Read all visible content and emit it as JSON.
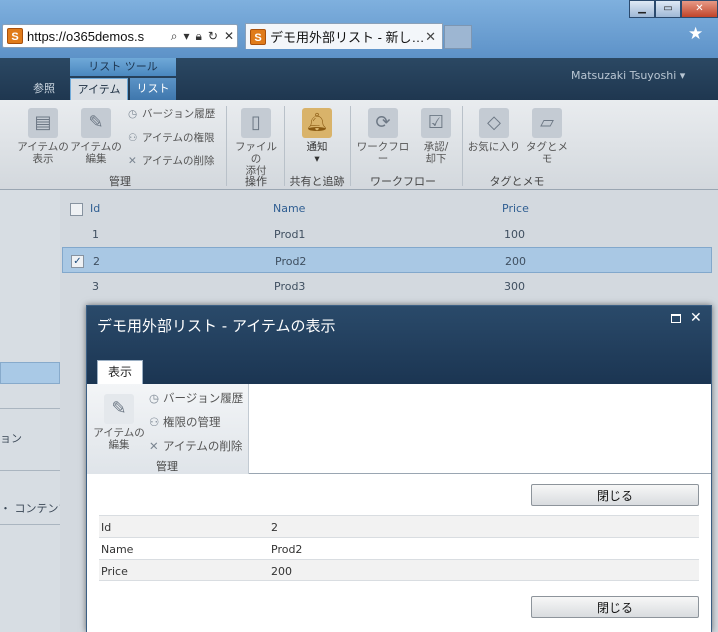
{
  "browser": {
    "favicon": "S",
    "address": "https://o365demos.s",
    "tab_title": "デモ用外部リスト - 新し…",
    "tab_favicon": "S"
  },
  "sp": {
    "context_group": "リスト ツール",
    "tabs": {
      "browse": "参照",
      "items": "アイテム",
      "list": "リスト"
    },
    "user": "Matsuzaki Tsuyoshi ▾"
  },
  "ribbon": {
    "view_item": [
      "アイテムの",
      "表示"
    ],
    "edit_item": [
      "アイテムの",
      "編集"
    ],
    "version_history": "バージョン履歴",
    "item_permissions": "アイテムの権限",
    "delete_item": "アイテムの削除",
    "group_manage": "管理",
    "attach_file": [
      "ファイルの",
      "添付"
    ],
    "group_actions": "操作",
    "alert": "通知",
    "group_share": "共有と追跡",
    "workflow": "ワークフロー",
    "approve": [
      "承認/",
      "却下"
    ],
    "group_workflow": "ワークフロー",
    "like": "お気に入り",
    "tags": "タグとメモ",
    "group_tags": "タグとメモ"
  },
  "left_nav": {
    "item1": "ョン",
    "item2": "・ コンテンツ"
  },
  "list": {
    "headers": {
      "id": "Id",
      "name": "Name",
      "price": "Price"
    },
    "rows": [
      {
        "id": "1",
        "name": "Prod1",
        "price": "100"
      },
      {
        "id": "2",
        "name": "Prod2",
        "price": "200"
      },
      {
        "id": "3",
        "name": "Prod3",
        "price": "300"
      }
    ]
  },
  "dialog": {
    "title": "デモ用外部リスト - アイテムの表示",
    "tab": "表示",
    "edit_item": [
      "アイテムの",
      "編集"
    ],
    "version_history": "バージョン履歴",
    "manage_permissions": "権限の管理",
    "delete_item": "アイテムの削除",
    "group_manage": "管理",
    "close_label": "閉じる",
    "fields": [
      {
        "label": "Id",
        "value": "2"
      },
      {
        "label": "Name",
        "value": "Prod2"
      },
      {
        "label": "Price",
        "value": "200"
      }
    ]
  }
}
